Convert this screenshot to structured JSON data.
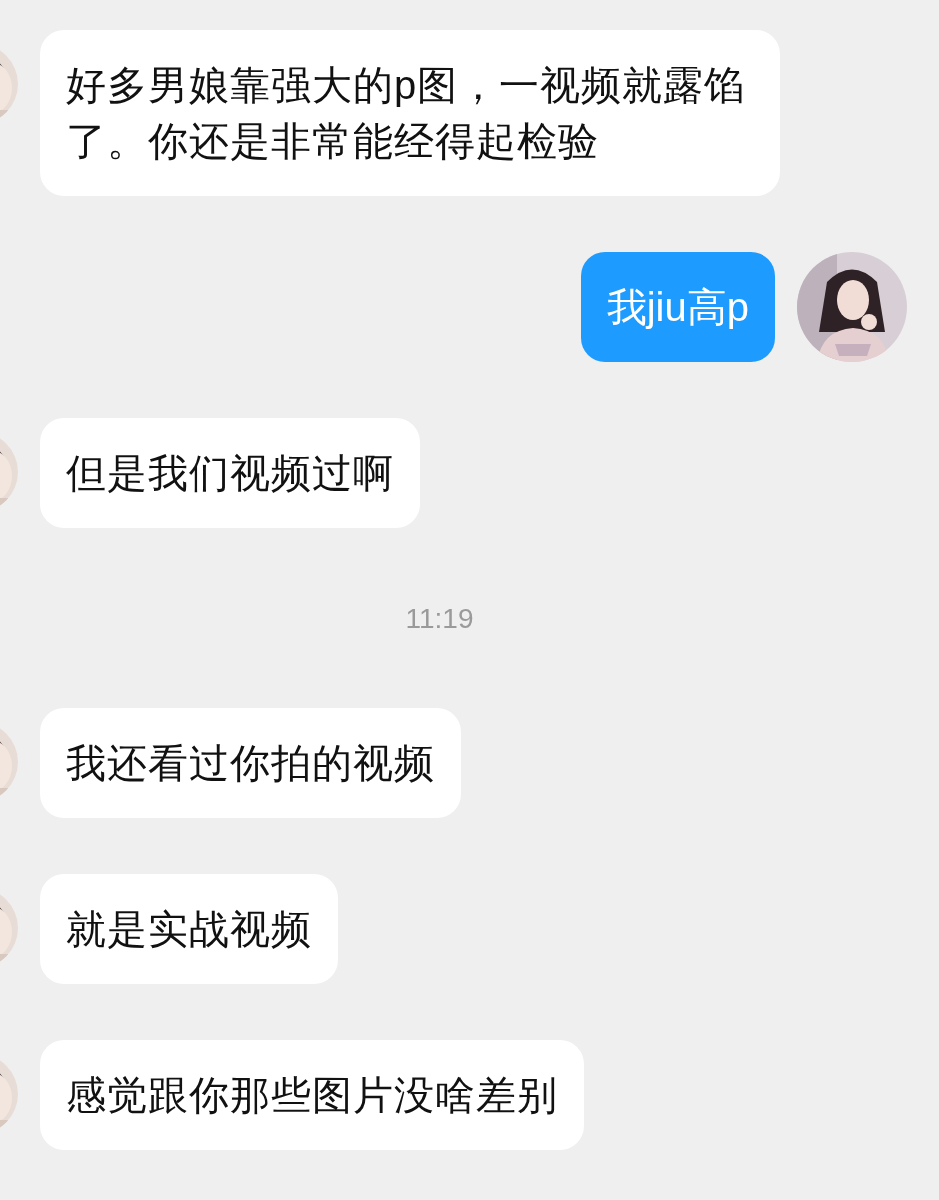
{
  "messages": [
    {
      "kind": "incoming",
      "text": "好多男娘靠强大的p图，一视频就露馅了。你还是非常能经得起检验"
    },
    {
      "kind": "outgoing",
      "text": "我jiu高p"
    },
    {
      "kind": "incoming",
      "text": "但是我们视频过啊"
    },
    {
      "kind": "timestamp",
      "text": "11:19"
    },
    {
      "kind": "incoming",
      "text": "我还看过你拍的视频"
    },
    {
      "kind": "incoming",
      "text": "就是实战视频"
    },
    {
      "kind": "incoming",
      "text": "感觉跟你那些图片没啥差别"
    }
  ]
}
